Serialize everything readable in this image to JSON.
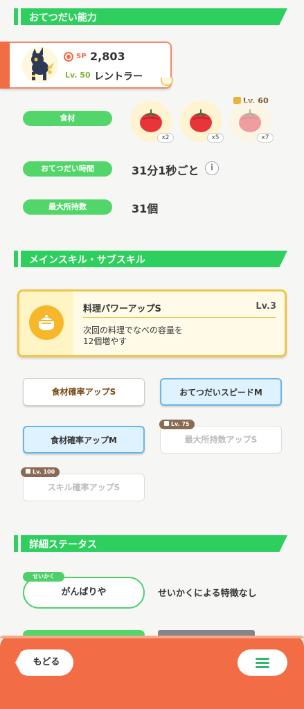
{
  "sections": {
    "help_ability": "おてつだい能力",
    "skills": "メインスキル・サブスキル",
    "details": "詳細ステータス"
  },
  "pokemon": {
    "sp_label": "SP",
    "sp_value": "2,803",
    "level": "Lv. 50",
    "name": "レントラー"
  },
  "stats": {
    "ingredients_label": "食材",
    "ingredients": [
      {
        "name": "tomato",
        "qty": "x2",
        "locked": false
      },
      {
        "name": "tomato",
        "qty": "x5",
        "locked": false
      },
      {
        "name": "tomato",
        "qty": "x7",
        "locked": true,
        "unlock_level": "Lv. 60"
      }
    ],
    "help_time_label": "おてつだい時間",
    "help_time_value": "31分1秒ごと",
    "info_icon": "i",
    "max_carry_label": "最大所持数",
    "max_carry_value": "31個"
  },
  "main_skill": {
    "name": "料理パワーアップS",
    "level": "Lv.3",
    "description_line1": "次回の料理でなべの容量を",
    "description_line2": "12個増やす"
  },
  "sub_skills": [
    {
      "label": "食材確率アップS",
      "style": "gold",
      "locked": false
    },
    {
      "label": "おてつだいスピードM",
      "style": "blue",
      "locked": false
    },
    {
      "label": "食材確率アップM",
      "style": "blue",
      "locked": false
    },
    {
      "label": "最大所持数アップS",
      "style": "locked",
      "locked": true,
      "unlock_level": "Lv. 75"
    },
    {
      "label": "スキル確率アップS",
      "style": "locked",
      "locked": true,
      "unlock_level": "Lv. 100"
    }
  ],
  "nature": {
    "tag": "せいかく",
    "value": "がんばりや",
    "description": "せいかくによる特徴なし"
  },
  "footer": {
    "back_label": "もどる"
  },
  "colors": {
    "section_green": "#2fcf5f",
    "accent_orange": "#f26c45",
    "gold": "#f2c34a",
    "blue": "#6ab4e8"
  }
}
